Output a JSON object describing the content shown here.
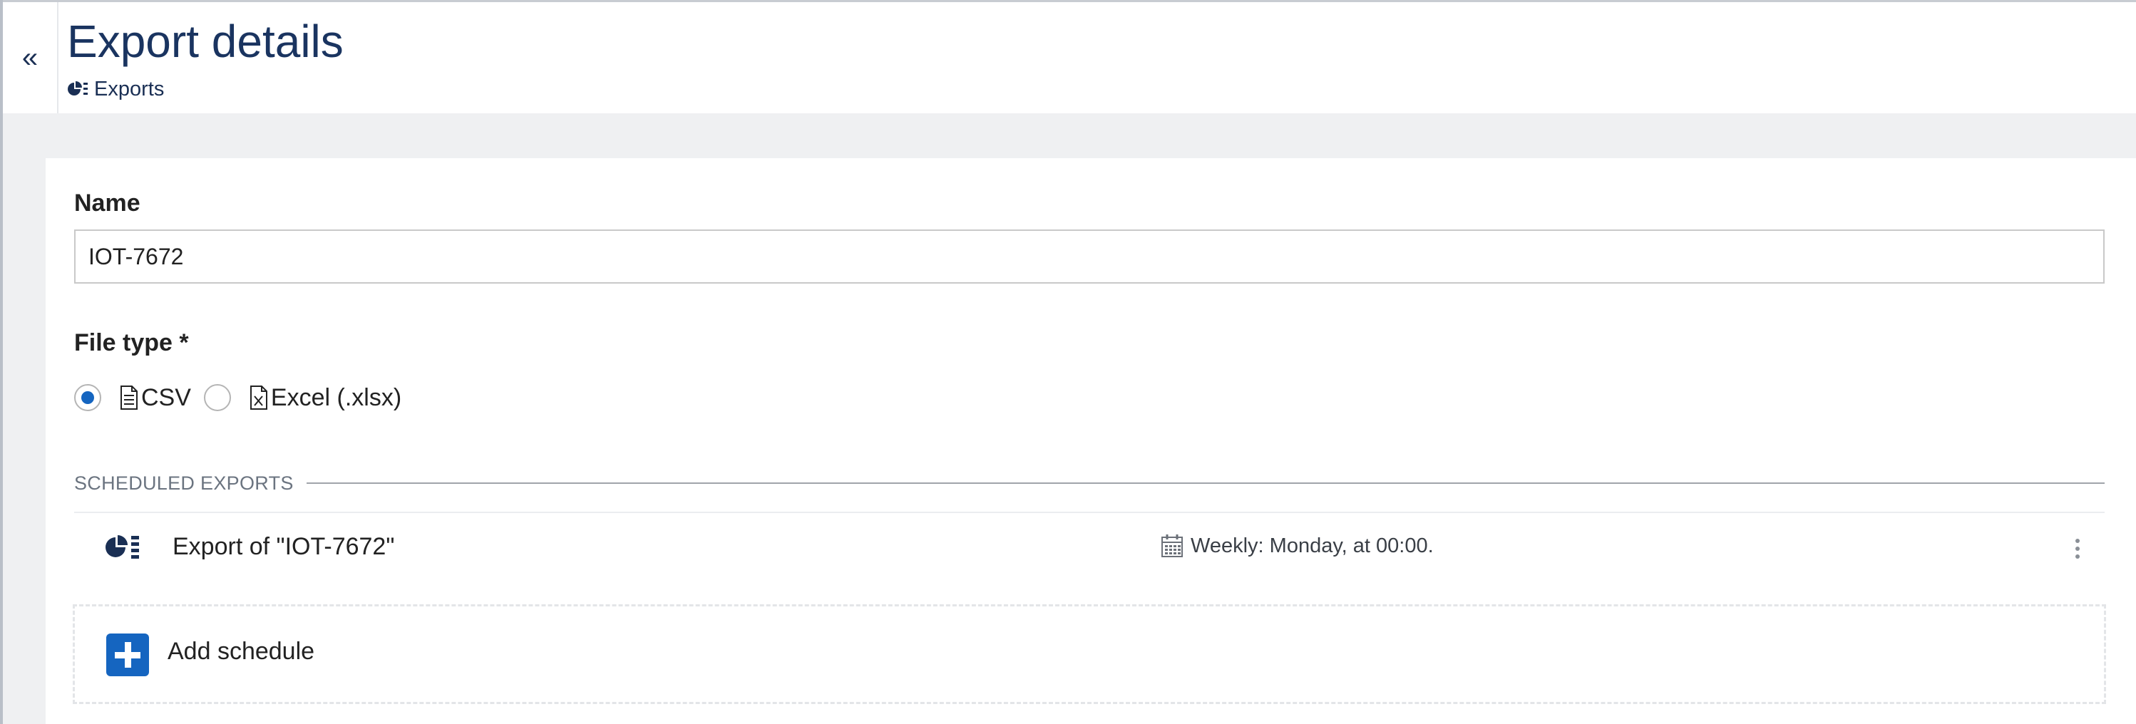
{
  "header": {
    "title": "Export details",
    "breadcrumb": "Exports",
    "collapse_glyph": "«"
  },
  "form": {
    "name_label": "Name",
    "name_value": "IOT-7672",
    "file_type_label": "File type *",
    "file_types": [
      {
        "label": "CSV",
        "selected": true,
        "icon": "document-icon"
      },
      {
        "label": "Excel (.xlsx)",
        "selected": false,
        "icon": "excel-file-icon"
      }
    ]
  },
  "scheduled": {
    "section_title": "SCHEDULED EXPORTS",
    "items": [
      {
        "name": "Export of \"IOT-7672\"",
        "schedule": "Weekly: Monday, at 00:00."
      }
    ],
    "add_label": "Add schedule"
  },
  "colors": {
    "accent": "#1565c0",
    "title": "#1a3460",
    "page_bg": "#eff0f2"
  }
}
